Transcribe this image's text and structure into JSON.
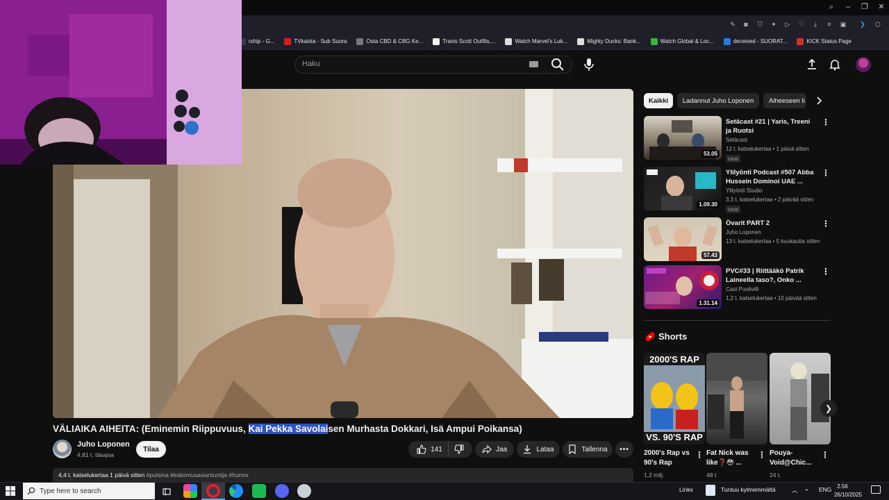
{
  "bookmarks": [
    {
      "label": "rship - G...",
      "color": "#3a3a4a"
    },
    {
      "label": "TVkaista - Sub Suora",
      "color": "#d02020"
    },
    {
      "label": "Osta CBD & CBG Ke...",
      "color": "#777777"
    },
    {
      "label": "Travis Scott Outfits,...",
      "color": "#f1f1f1"
    },
    {
      "label": "Watch Marvel's Luk...",
      "color": "#dddddd"
    },
    {
      "label": "Mighty Ducks: Bank...",
      "color": "#dddddd"
    },
    {
      "label": "Watch Global & Loc...",
      "color": "#3bb34a"
    },
    {
      "label": "deceived - SUORAT...",
      "color": "#2a7ad8"
    },
    {
      "label": "KICK Status Page",
      "color": "#c0392b"
    }
  ],
  "search": {
    "placeholder": "Haku"
  },
  "video": {
    "title_before": "VÄLIAIKA AIHEITA: (Eminemin Riippuvuus, ",
    "title_highlight": "Kai Pekka Savolai",
    "title_after": "sen Murhasta Dokkari, Isä Ampui Poikansa)",
    "channel": "Juho Loponen",
    "subscribers": "4,81 t. tilaajaa",
    "subscribe_label": "Tilaa",
    "likes": "141",
    "share_label": "Jaa",
    "download_label": "Lataa",
    "save_label": "Tallenna",
    "description_meta": "4,4 t. katselukertaa  1 päivä sitten",
    "description_tags": "#putsina #kokomusasiantuntija #humor"
  },
  "chips": [
    "Kaikki",
    "Ladannut Juho Loponen",
    "Aiheeseen li"
  ],
  "related": [
    {
      "title": "Setäcast #21 | Yaris, Treeni ja Ruotsi",
      "channel": "Setäcast",
      "meta": "12 t. katselukertaa • 1 päivä sitten",
      "badge": "Uusi",
      "duration": "53.05"
    },
    {
      "title": "Ylilyönti Podcast #507 Abba Hussein Dominoi UAE ...",
      "channel": "Ylilyönti Studio",
      "meta": "3,3 t. katselukertaa • 2 päivää sitten",
      "badge": "Uusi",
      "duration": "1.09.30"
    },
    {
      "title": "Övarit PART 2",
      "channel": "Juho Loponen",
      "meta": "13 t. katselukertaa • 5 kuukautta sitten",
      "badge": "",
      "duration": "57.43"
    },
    {
      "title": "PVC#33 | Riittääkö Patrik Laineella taso?, Onko ...",
      "channel": "Cast Puolivilli",
      "meta": "1,2 t. katselukertaa • 10 päivää sitten",
      "badge": "",
      "duration": "1.31.14"
    }
  ],
  "shorts": {
    "heading": "Shorts",
    "items": [
      {
        "title": "2000's Rap vs 90's Rap",
        "views": "1,2 milj.",
        "thumb_top": "2000'S RAP",
        "thumb_bottom": "VS. 90'S RAP"
      },
      {
        "title": "Fat Nick was like❓😳 ...",
        "views": "48 t.",
        "thumb_top": "",
        "thumb_bottom": ""
      },
      {
        "title": "Pouya-Void@Chic...",
        "views": "24 t.",
        "thumb_top": "",
        "thumb_bottom": ""
      }
    ]
  },
  "taskbar": {
    "search_placeholder": "Type here to search",
    "links": "Links",
    "weather": "Tuntuu kylmemmältä",
    "lang": "ENG",
    "time": "2.56",
    "date": "26/10/2025"
  },
  "colors": {
    "accent": "#ff0000",
    "highlight": "#2c52c8",
    "background": "#0f0f0f"
  }
}
